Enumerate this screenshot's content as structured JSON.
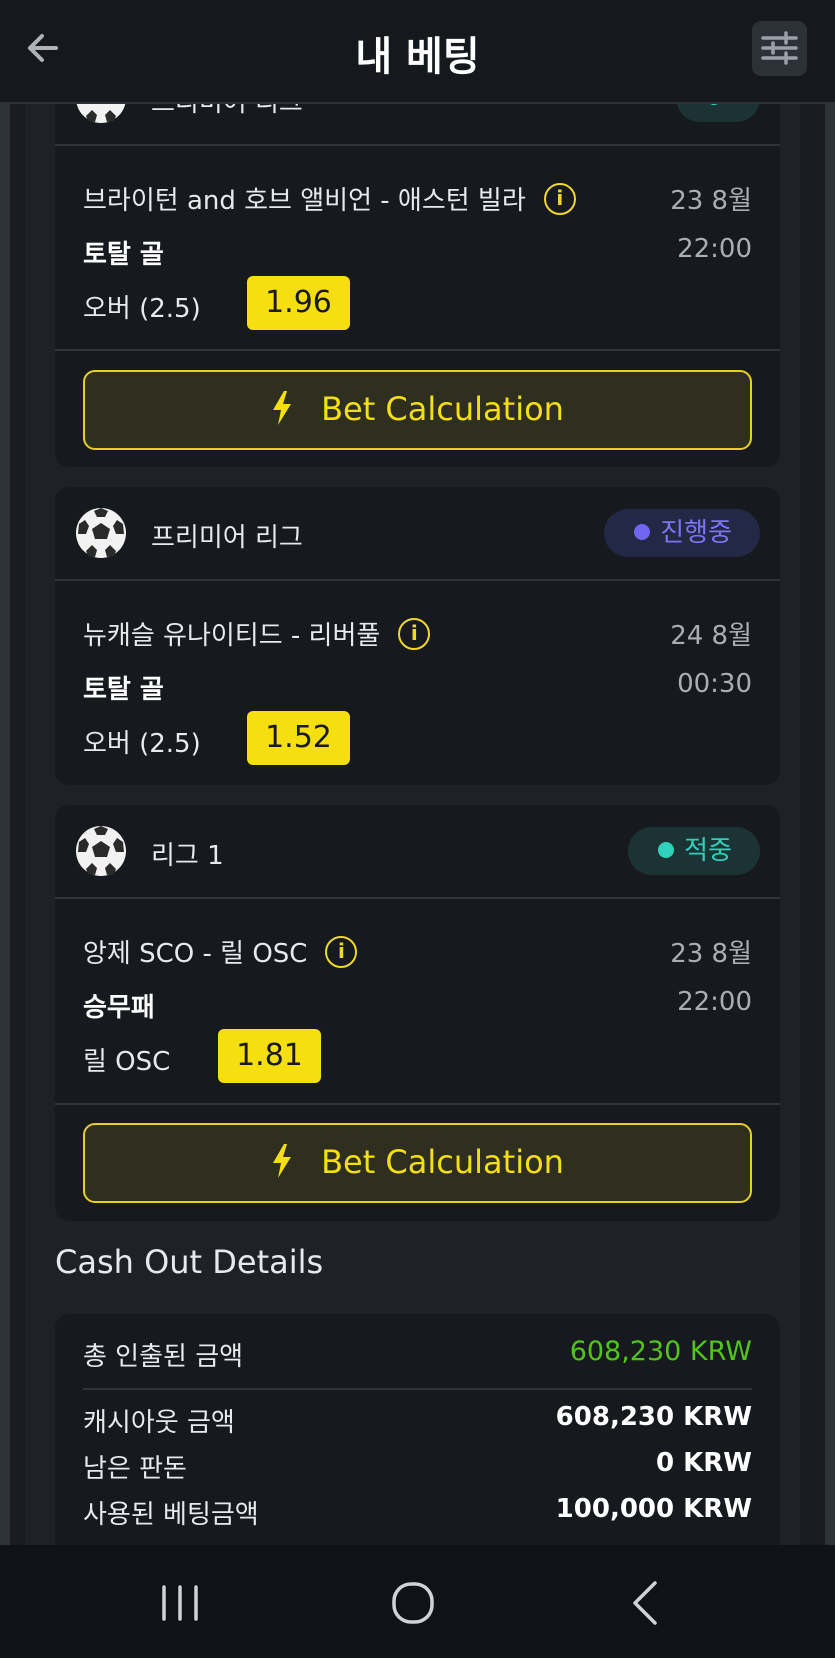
{
  "header": {
    "title": "내 베팅",
    "back_icon": "arrow-left-icon",
    "filter_icon": "sliders-icon"
  },
  "bets": [
    {
      "league": "프리미어 리그",
      "status": "",
      "match": "브라이턴 and 호브 앨비언 - 애스턴 빌라",
      "date": "23 8월",
      "market": "토탈 골",
      "time": "22:00",
      "pick": "오버 (2.5)",
      "odds": "1.96",
      "calc_label": "Bet Calculation"
    },
    {
      "league": "프리미어 리그",
      "status": "진행중",
      "match": "뉴캐슬 유나이티드 - 리버풀",
      "date": "24 8월",
      "market": "토탈 골",
      "time": "00:30",
      "pick": "오버 (2.5)",
      "odds": "1.52"
    },
    {
      "league": "리그 1",
      "status": "적중",
      "match": "앙제 SCO - 릴 OSC",
      "date": "23 8월",
      "market": "승무패",
      "time": "22:00",
      "pick": "릴 OSC",
      "odds": "1.81",
      "calc_label": "Bet Calculation"
    }
  ],
  "cashout": {
    "title": "Cash Out Details",
    "total_label": "총 인출된 금액",
    "total_value": "608,230 KRW",
    "rows": [
      {
        "label": "캐시아웃 금액",
        "value": "608,230 KRW"
      },
      {
        "label": "남은 판돈",
        "value": "0 KRW"
      },
      {
        "label": "사용된 베팅금액",
        "value": "100,000 KRW"
      }
    ]
  },
  "colors": {
    "accent": "#f5df10",
    "live": "#6e66f0",
    "won": "#2fd1bb",
    "positive": "#52c41a"
  }
}
